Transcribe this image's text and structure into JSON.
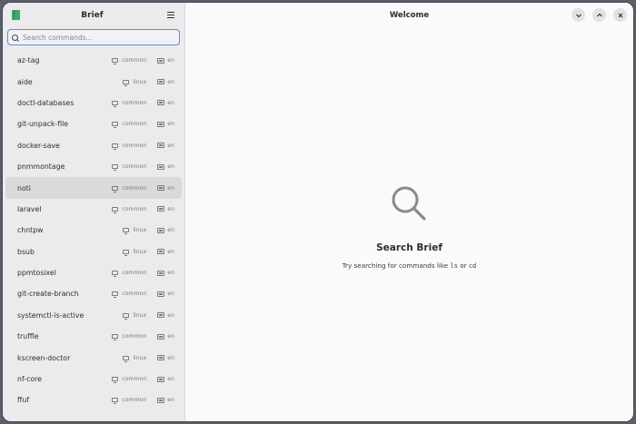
{
  "sidebar": {
    "title": "Brief",
    "search_placeholder": "Search commands...",
    "items": [
      {
        "name": "az-tag",
        "platform": "common",
        "lang": "en"
      },
      {
        "name": "aide",
        "platform": "linux",
        "lang": "en"
      },
      {
        "name": "doctl-databases",
        "platform": "common",
        "lang": "en"
      },
      {
        "name": "git-unpack-file",
        "platform": "common",
        "lang": "en"
      },
      {
        "name": "docker-save",
        "platform": "common",
        "lang": "en"
      },
      {
        "name": "pnmmontage",
        "platform": "common",
        "lang": "en"
      },
      {
        "name": "noti",
        "platform": "common",
        "lang": "en",
        "selected": true
      },
      {
        "name": "laravel",
        "platform": "common",
        "lang": "en"
      },
      {
        "name": "chntpw",
        "platform": "linux",
        "lang": "en"
      },
      {
        "name": "bsub",
        "platform": "linux",
        "lang": "en"
      },
      {
        "name": "ppmtosixel",
        "platform": "common",
        "lang": "en"
      },
      {
        "name": "git-create-branch",
        "platform": "common",
        "lang": "en"
      },
      {
        "name": "systemctl-is-active",
        "platform": "linux",
        "lang": "en"
      },
      {
        "name": "truffle",
        "platform": "common",
        "lang": "en"
      },
      {
        "name": "kscreen-doctor",
        "platform": "linux",
        "lang": "en"
      },
      {
        "name": "nf-core",
        "platform": "common",
        "lang": "en"
      },
      {
        "name": "ffuf",
        "platform": "common",
        "lang": "en"
      }
    ]
  },
  "main": {
    "title": "Welcome",
    "placeholder_title": "Search Brief",
    "placeholder_prefix": "Try searching for commands like ",
    "placeholder_code1": "ls",
    "placeholder_mid": " or ",
    "placeholder_code2": "cd"
  },
  "icons": {
    "app": "brief-book-icon",
    "menu": "hamburger-menu-icon",
    "search": "search-icon",
    "platform": "monitor-icon",
    "language": "language-icon",
    "minimize": "chevron-down-icon",
    "maximize": "chevron-up-icon",
    "close": "close-icon"
  },
  "colors": {
    "accent": "#5c8fd6",
    "app_icon": "#3fa86a",
    "sidebar_bg": "#ebebed",
    "selected_row": "#dadadc"
  }
}
